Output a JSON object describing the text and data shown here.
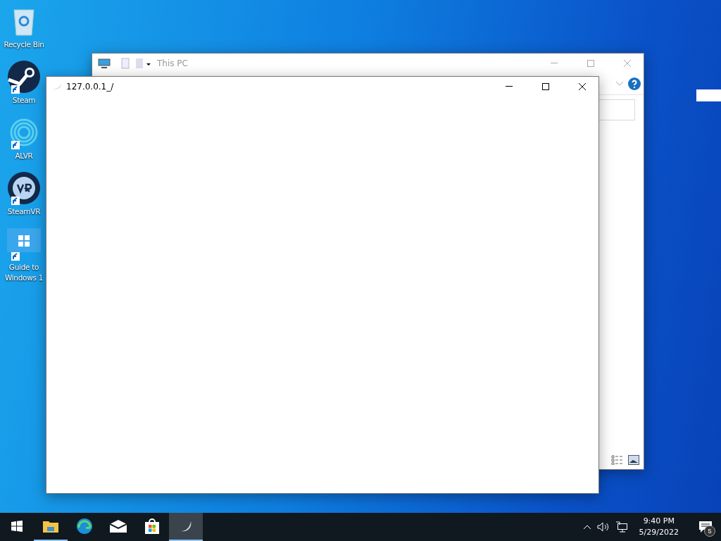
{
  "desktop_icons": [
    {
      "kind": "recycle",
      "label": "Recycle Bin",
      "shortcut": false
    },
    {
      "kind": "steam",
      "label": "Steam",
      "shortcut": true
    },
    {
      "kind": "alvr",
      "label": "ALVR",
      "shortcut": true
    },
    {
      "kind": "steamvr",
      "label": "SteamVR",
      "shortcut": true
    },
    {
      "kind": "guide",
      "label": "Guide to Windows 1",
      "shortcut": true
    }
  ],
  "explorer_window": {
    "title": "This PC"
  },
  "front_window": {
    "title": "127.0.0.1_/"
  },
  "taskbar": {
    "items": [
      {
        "kind": "explorer",
        "running": true,
        "selected": false
      },
      {
        "kind": "edge",
        "running": false,
        "selected": false
      },
      {
        "kind": "mail",
        "running": false,
        "selected": false
      },
      {
        "kind": "store",
        "running": false,
        "selected": false
      },
      {
        "kind": "app",
        "running": true,
        "selected": true
      }
    ],
    "time": "9:40 PM",
    "date": "5/29/2022",
    "notifications": "5"
  }
}
